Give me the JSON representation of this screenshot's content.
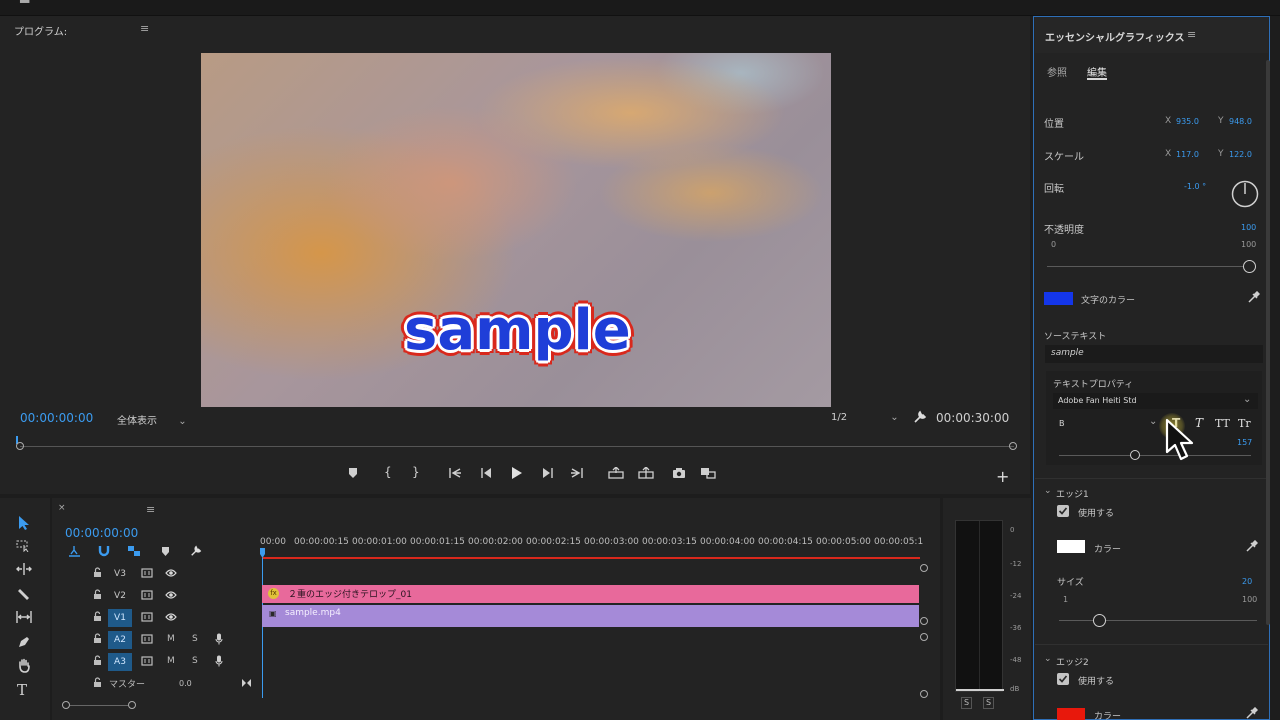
{
  "program": {
    "title": "プログラム:",
    "menu_icon": "≡",
    "overlay_text": "sample",
    "timecode_current": "00:00:00:00",
    "fit": "全体表示",
    "resolution": "1/2",
    "timecode_duration": "00:00:30:00",
    "add": "+"
  },
  "eg": {
    "title": "エッセンシャルグラフィックス",
    "menu_icon": "≡",
    "tabs": [
      "参照",
      "編集"
    ],
    "position": {
      "label": "位置",
      "x_label": "X",
      "x": "935.0",
      "y_label": "Y",
      "y": "948.0"
    },
    "scale": {
      "label": "スケール",
      "x_label": "X",
      "x": "117.0",
      "y_label": "Y",
      "y": "122.0"
    },
    "rotation": {
      "label": "回転",
      "value": "-1.0 °"
    },
    "opacity": {
      "label": "不透明度",
      "value": "100",
      "min": "0",
      "max": "100",
      "level": 1.0
    },
    "fill": {
      "label": "文字のカラー",
      "color": "#1436ea"
    },
    "source_text": {
      "label": "ソーステキスト",
      "value": "sample"
    },
    "text_props": {
      "label": "テキストプロパティ",
      "font": "Adobe Fan Heiti Std",
      "weight": "B",
      "size": "157",
      "style_buttons": [
        "T",
        "T",
        "TT",
        "Tr"
      ]
    },
    "edge1": {
      "label": "エッジ1",
      "use_label": "使用する",
      "color_label": "カラー",
      "color": "#ffffff",
      "size_label": "サイズ",
      "size": "20",
      "min": "1",
      "max": "100",
      "level": 0.2
    },
    "edge2": {
      "label": "エッジ2",
      "use_label": "使用する",
      "color_label": "カラー",
      "color": "#e8180c"
    }
  },
  "timeline": {
    "close": "×",
    "menu_icon": "≡",
    "timecode": "00:00:00:00",
    "ruler": [
      "00:00",
      "00:00:00:15",
      "00:00:01:00",
      "00:00:01:15",
      "00:00:02:00",
      "00:00:02:15",
      "00:00:03:00",
      "00:00:03:15",
      "00:00:04:00",
      "00:00:04:15",
      "00:00:05:00",
      "00:00:05:1"
    ],
    "tracks": [
      {
        "id": "V3",
        "active": false,
        "kind": "video"
      },
      {
        "id": "V2",
        "active": false,
        "kind": "video"
      },
      {
        "id": "V1",
        "active": true,
        "kind": "video"
      },
      {
        "id": "A2",
        "active": true,
        "kind": "audio"
      },
      {
        "id": "A3",
        "active": true,
        "kind": "audio"
      }
    ],
    "mute": "M",
    "solo": "S",
    "master": {
      "label": "マスター",
      "value": "0.0"
    },
    "clips": [
      {
        "name": "２重のエッジ付きテロップ_01",
        "color": "#e8699b",
        "badge": "fx"
      },
      {
        "name": "sample.mp4",
        "color": "#a58ad8",
        "badge": "▣"
      }
    ]
  },
  "meter": {
    "scale": [
      "0",
      "-12",
      "-24",
      "-36",
      "-48",
      "dB"
    ],
    "solo": [
      "S",
      "S"
    ]
  }
}
